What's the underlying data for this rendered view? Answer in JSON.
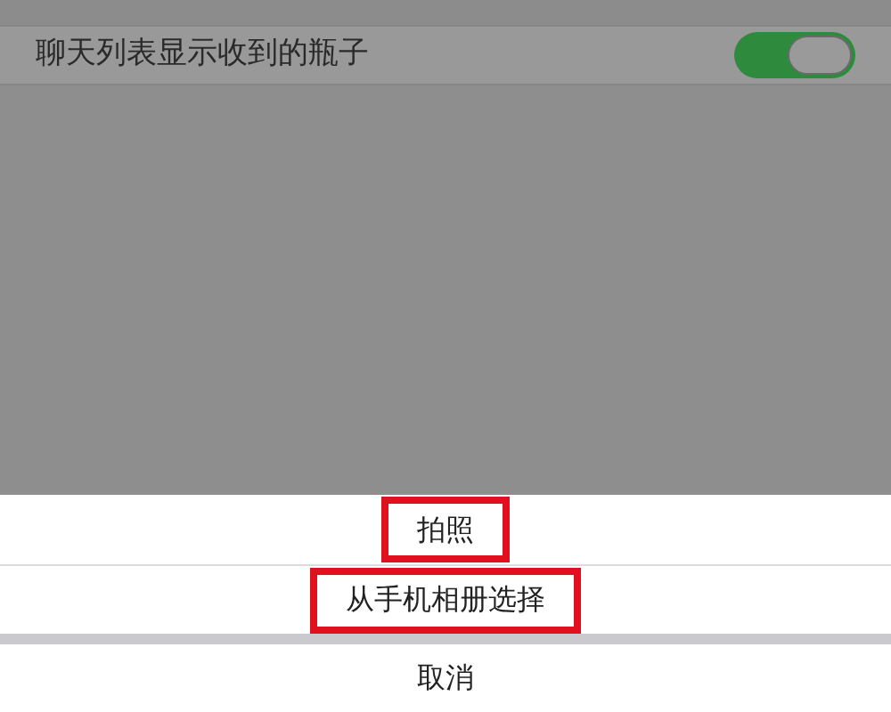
{
  "setting_row": {
    "label": "聊天列表显示收到的瓶子",
    "on": true
  },
  "action_sheet": {
    "options": [
      {
        "label": "拍照",
        "highlighted": true
      },
      {
        "label": "从手机相册选择",
        "highlighted": true
      }
    ],
    "cancel": "取消"
  }
}
